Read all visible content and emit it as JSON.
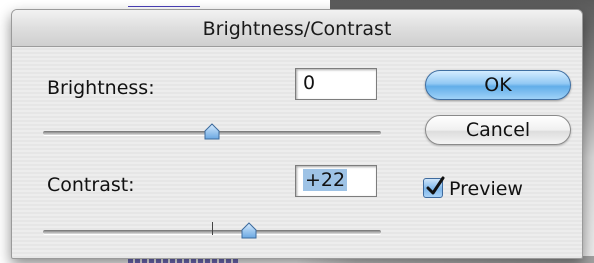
{
  "dialog": {
    "title": "Brightness/Contrast"
  },
  "brightness": {
    "label": "Brightness:",
    "value": "0",
    "slider_fraction": 0.5
  },
  "contrast": {
    "label": "Contrast:",
    "value": "+22",
    "slider_fraction": 0.61
  },
  "buttons": {
    "ok_label": "OK",
    "cancel_label": "Cancel"
  },
  "preview": {
    "label": "Preview",
    "checked": true
  },
  "colors": {
    "ok_button": "#62aee9",
    "selection": "#9ec3e6",
    "check_mark": "#111111"
  },
  "icons": {
    "slider_thumb": "slider-thumb-icon",
    "check": "checkmark-icon"
  }
}
